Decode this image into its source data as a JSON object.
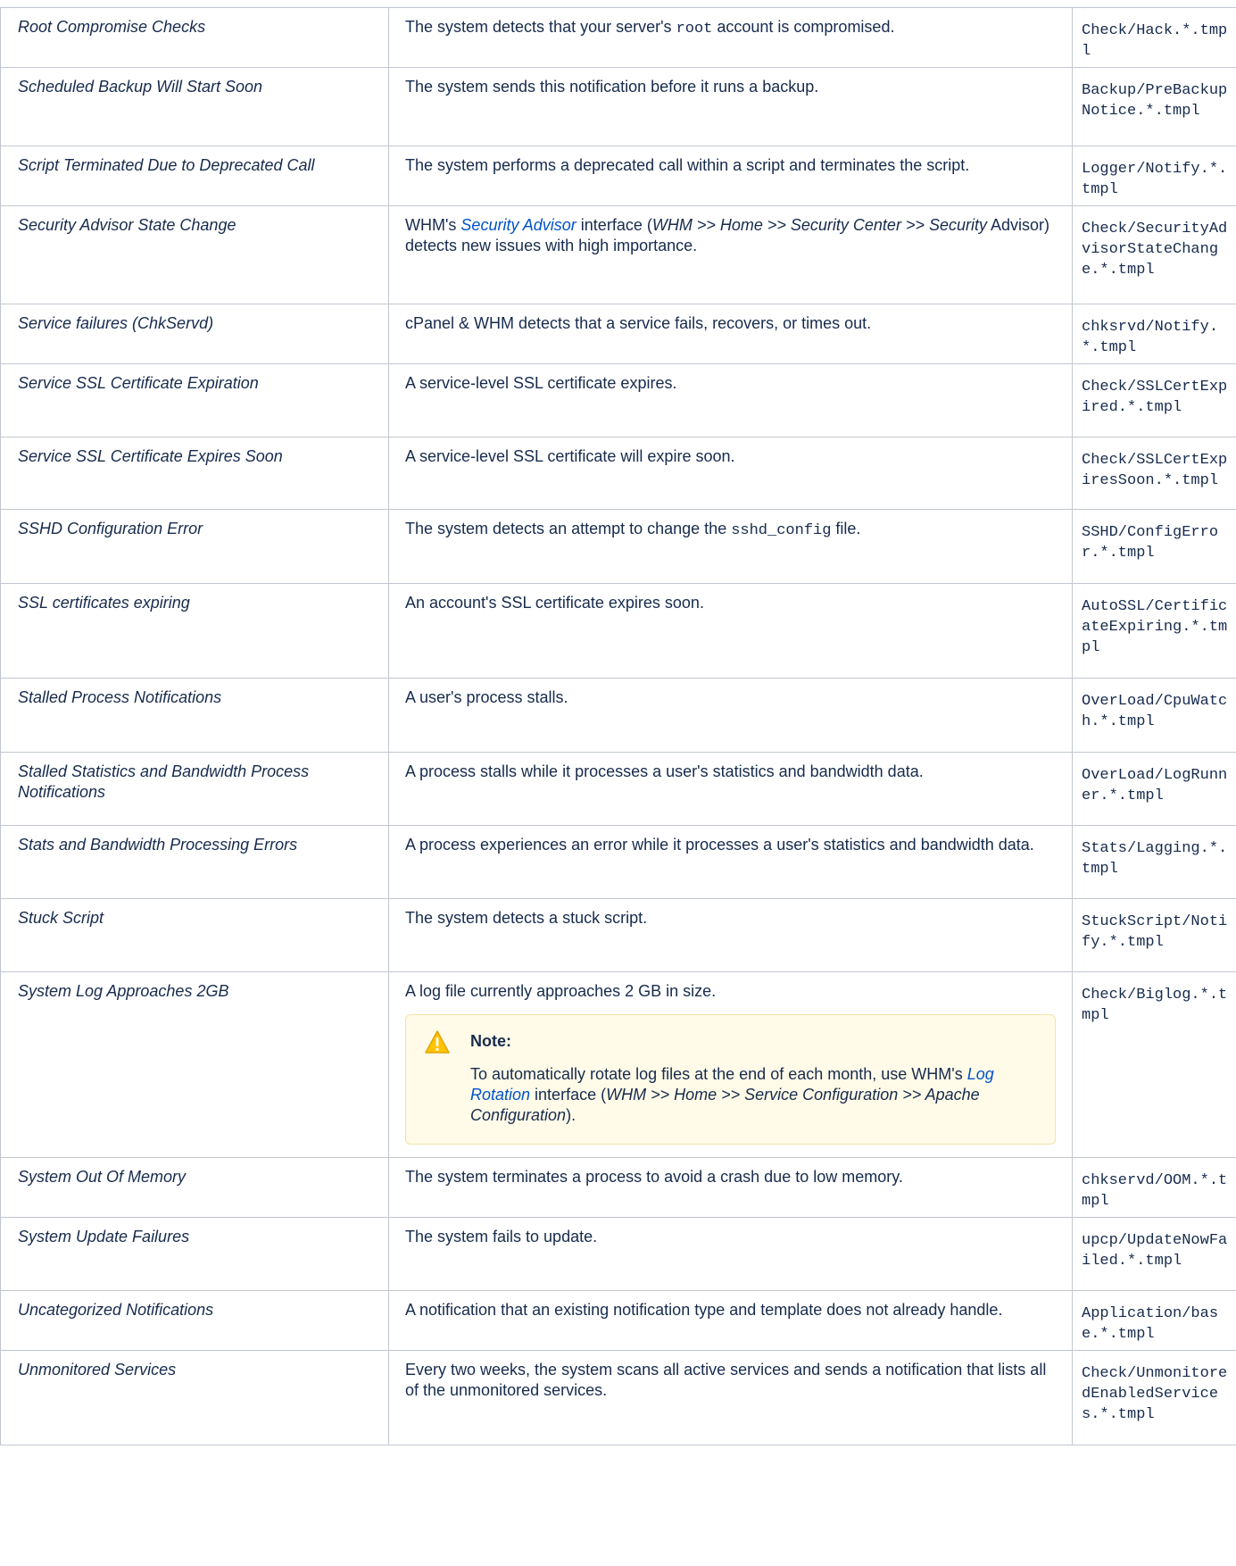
{
  "rows": [
    {
      "name": "Root Compromise Checks",
      "desc_pre": "The system detects that your server's ",
      "desc_code": "root",
      "desc_post": " account is compromised.",
      "tmpl": "Check/Hack.*.tmpl"
    },
    {
      "name": "Scheduled Backup Will Start Soon",
      "desc": "The system sends this notification before it runs a backup.",
      "tmpl": "Backup/PreBackupNotice.*.tmpl"
    },
    {
      "name": "Script Terminated Due to Deprecated Call",
      "desc": "The system performs a deprecated call within a script and terminates the script.",
      "tmpl": "Logger/Notify.*.tmpl"
    },
    {
      "name": "Security Advisor State Change",
      "desc_pre": "WHM's ",
      "desc_link": "Security Advisor",
      "desc_mid": " interface (",
      "desc_path": "WHM >> Home >> Security Center >> Security",
      "desc_post": " Advisor) detects new issues with high importance.",
      "tmpl": "Check/SecurityAdvisorStateChange.*.tmpl"
    },
    {
      "name": "Service failures (ChkServd)",
      "desc": "cPanel & WHM detects that a service fails, recovers, or times out.",
      "tmpl": "chksrvd/Notify.*.tmpl"
    },
    {
      "name": "Service SSL Certificate Expiration",
      "desc": "A service-level SSL certificate expires.",
      "tmpl": "Check/SSLCertExpired.*.tmpl"
    },
    {
      "name": "Service SSL Certificate Expires Soon",
      "desc": "A service-level SSL certificate will expire soon.",
      "tmpl": "Check/SSLCertExpiresSoon.*.tmpl"
    },
    {
      "name": "SSHD Configuration Error",
      "desc_pre": "The system detects an attempt to change the ",
      "desc_code": "sshd_config",
      "desc_post": " file.",
      "tmpl": "SSHD/ConfigError.*.tmpl"
    },
    {
      "name": "SSL certificates expiring",
      "desc": "An account's SSL certificate expires soon.",
      "tmpl": "AutoSSL/CertificateExpiring.*.tmpl"
    },
    {
      "name": "Stalled Process Notifications",
      "desc": "A user's process stalls.",
      "tmpl": "OverLoad/CpuWatch.*.tmpl"
    },
    {
      "name": "Stalled Statistics and Bandwidth Process Notifications",
      "desc": "A process stalls while it processes a user's statistics and bandwidth data.",
      "tmpl": "OverLoad/LogRunner.*.tmpl"
    },
    {
      "name": "Stats and Bandwidth Processing Errors",
      "desc": "A process experiences an error while it processes a user's statistics and bandwidth data.",
      "tmpl": "Stats/Lagging.*.tmpl"
    },
    {
      "name": "Stuck Script",
      "desc": "The system detects a stuck script.",
      "tmpl": "StuckScript/Notify.*.tmpl"
    },
    {
      "name": "System Log Approaches 2GB",
      "desc": "A log file currently approaches 2 GB in size.",
      "tmpl": "Check/Biglog.*.tmpl",
      "note": {
        "title": "Note:",
        "pre": "To automatically rotate log files at the end of each month, use WHM's ",
        "link": "Log Rotation",
        "mid": " interface (",
        "path": "WHM >> Home >> Service Configuration >> Apache Configuration",
        "post": ")."
      }
    },
    {
      "name": "System Out Of Memory",
      "desc": "The system terminates a process to avoid a crash due to low memory.",
      "tmpl": "chkservd/OOM.*.tmpl"
    },
    {
      "name": "System Update Failures",
      "desc": "The system fails to update.",
      "tmpl": "upcp/UpdateNowFailed.*.tmpl"
    },
    {
      "name": "Uncategorized Notifications",
      "desc": "A notification that an existing notification type and template does not already handle.",
      "tmpl": "Application/base.*.tmpl"
    },
    {
      "name": "Unmonitored Services",
      "desc": "Every two weeks, the system scans all active services and sends a notification that lists all of the unmonitored services.",
      "tmpl": "Check/UnmonitoredEnabledServices.*.tmpl"
    }
  ]
}
